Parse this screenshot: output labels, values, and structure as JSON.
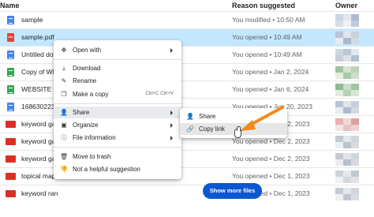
{
  "header": {
    "name": "Name",
    "reason": "Reason suggested",
    "owner": "Owner"
  },
  "files": [
    {
      "name": "sample",
      "type": "doc",
      "reason": "You modified • 10:50 AM"
    },
    {
      "name": "sample.pdf",
      "type": "pdf",
      "reason": "You opened • 10:49 AM"
    },
    {
      "name": "Untitled doc",
      "type": "doc",
      "reason": "You opened • 10:49 AM"
    },
    {
      "name": "Copy of WEB",
      "type": "sheet",
      "reason": "You opened • Jan 2, 2024"
    },
    {
      "name": "WEBSITE OF",
      "type": "sheet",
      "reason": "You opened • Jan 6, 2024"
    },
    {
      "name": "1686302239",
      "type": "doc",
      "reason": "You opened • Jun 20, 2023"
    },
    {
      "name": "keyword gap",
      "type": "ppt",
      "reason": "You opened • Dec 2, 2023"
    },
    {
      "name": "keyword gap",
      "type": "ppt",
      "reason": "You opened • Dec 2, 2023"
    },
    {
      "name": "keyword gap",
      "type": "ppt",
      "reason": "You opened • Dec 2, 2023"
    },
    {
      "name": "topical map",
      "type": "ppt",
      "reason": "You opened • Dec 1, 2023"
    },
    {
      "name": "keyword ran",
      "type": "ppt",
      "reason": "You opened • Dec 1, 2023"
    }
  ],
  "context_menu": {
    "open_with": "Open with",
    "download": "Download",
    "rename": "Rename",
    "make_copy": "Make a copy",
    "make_copy_shortcut": "Ctrl+C Ctrl+V",
    "share": "Share",
    "organize": "Organize",
    "file_information": "File information",
    "move_to_trash": "Move to trash",
    "not_helpful": "Not a helpful suggestion"
  },
  "share_submenu": {
    "share": "Share",
    "copy_link": "Copy link"
  },
  "show_more": "Show more files",
  "colors": {
    "accent": "#0b57d0",
    "selected_row": "#c2e7ff",
    "annotation_arrow": "#f28a1e"
  }
}
